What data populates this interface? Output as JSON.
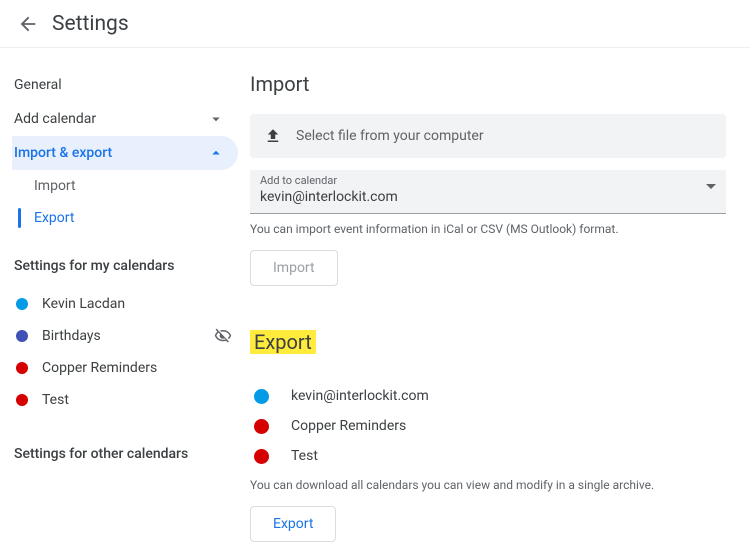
{
  "header": {
    "title": "Settings"
  },
  "sidebar": {
    "general": "General",
    "add_calendar": "Add calendar",
    "import_export": "Import & export",
    "import": "Import",
    "export": "Export",
    "my_calendars_heading": "Settings for my calendars",
    "other_calendars_heading": "Settings for other calendars",
    "my_calendars": [
      {
        "label": "Kevin Lacdan",
        "color": "#039be5",
        "hidden": false
      },
      {
        "label": "Birthdays",
        "color": "#3f51b5",
        "hidden": true
      },
      {
        "label": "Copper Reminders",
        "color": "#d50000",
        "hidden": false
      },
      {
        "label": "Test",
        "color": "#d50000",
        "hidden": false
      }
    ]
  },
  "import_panel": {
    "heading": "Import",
    "file_button": "Select file from your computer",
    "select_label": "Add to calendar",
    "select_value": "kevin@interlockit.com",
    "help": "You can import event information in iCal or CSV (MS Outlook) format.",
    "import_button": "Import"
  },
  "export_panel": {
    "heading": "Export",
    "calendars": [
      {
        "label": "kevin@interlockit.com",
        "color": "#039be5"
      },
      {
        "label": "Copper Reminders",
        "color": "#d50000"
      },
      {
        "label": "Test",
        "color": "#d50000"
      }
    ],
    "help": "You can download all calendars you can view and modify in a single archive.",
    "export_button": "Export"
  }
}
